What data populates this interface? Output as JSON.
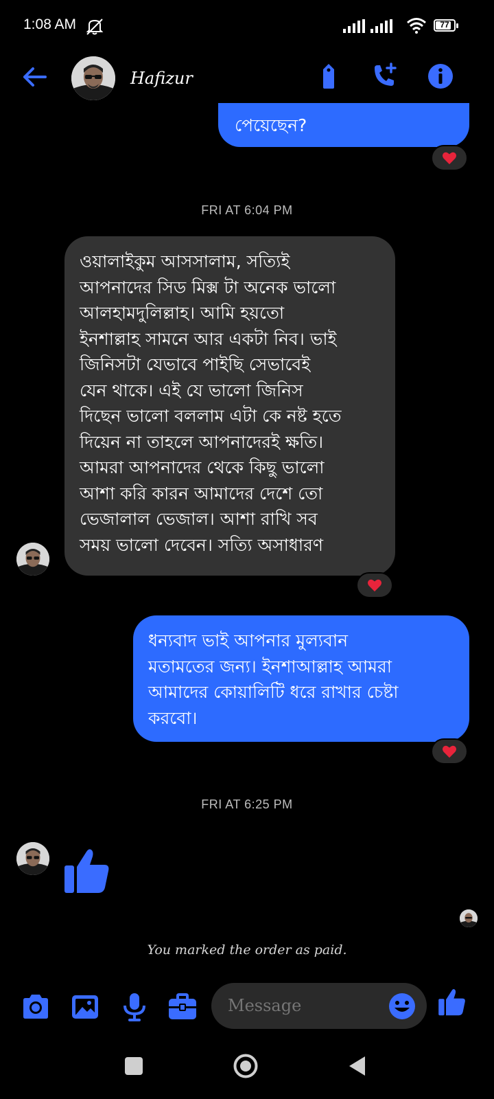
{
  "status_bar": {
    "time": "1:08 AM",
    "battery": "77"
  },
  "header": {
    "contact_name": "Hafizur"
  },
  "messages": {
    "m1_text": "পেয়েছেন?",
    "sep1": "FRI AT 6:04 PM",
    "m2_lines": [
      "ওয়ালাইকুম আসসালাম, সত্যিই",
      "আপনাদের সিড মিক্স টা অনেক ভালো",
      "আলহামদুলিল্লাহ। আমি হয়তো",
      "ইনশাল্লাহ সামনে আর একটা নিব। ভাই",
      "জিনিসটা যেভাবে পাইছি সেভাবেই",
      "যেন থাকে। এই যে ভালো জিনিস",
      "দিছেন ভালো বললাম এটা কে নষ্ট হতে",
      "দিয়েন না তাহলে আপনাদেরই ক্ষতি।",
      "আমরা আপনাদের থেকে কিছু ভালো",
      "আশা করি কারন আমাদের দেশে তো",
      "ভেজালাল ভেজাল। আশা রাখি সব",
      "সময় ভালো দেবেন। সত্যি অসাধারণ"
    ],
    "m3_lines": [
      "ধন্যবাদ ভাই আপনার মুল্যবান",
      "মতামতের জন্য। ইনশাআল্লাহ আমরা",
      "আমাদের কোয়ালিটি ধরে রাখার চেষ্টা",
      "করবো।"
    ],
    "sep2": "FRI AT 6:25 PM",
    "system_note": "You marked the order as paid."
  },
  "composer": {
    "placeholder": "Message"
  },
  "colors": {
    "accent": "#2d6bff",
    "icon_blue": "#3a6cff",
    "heart": "#e8243b"
  }
}
